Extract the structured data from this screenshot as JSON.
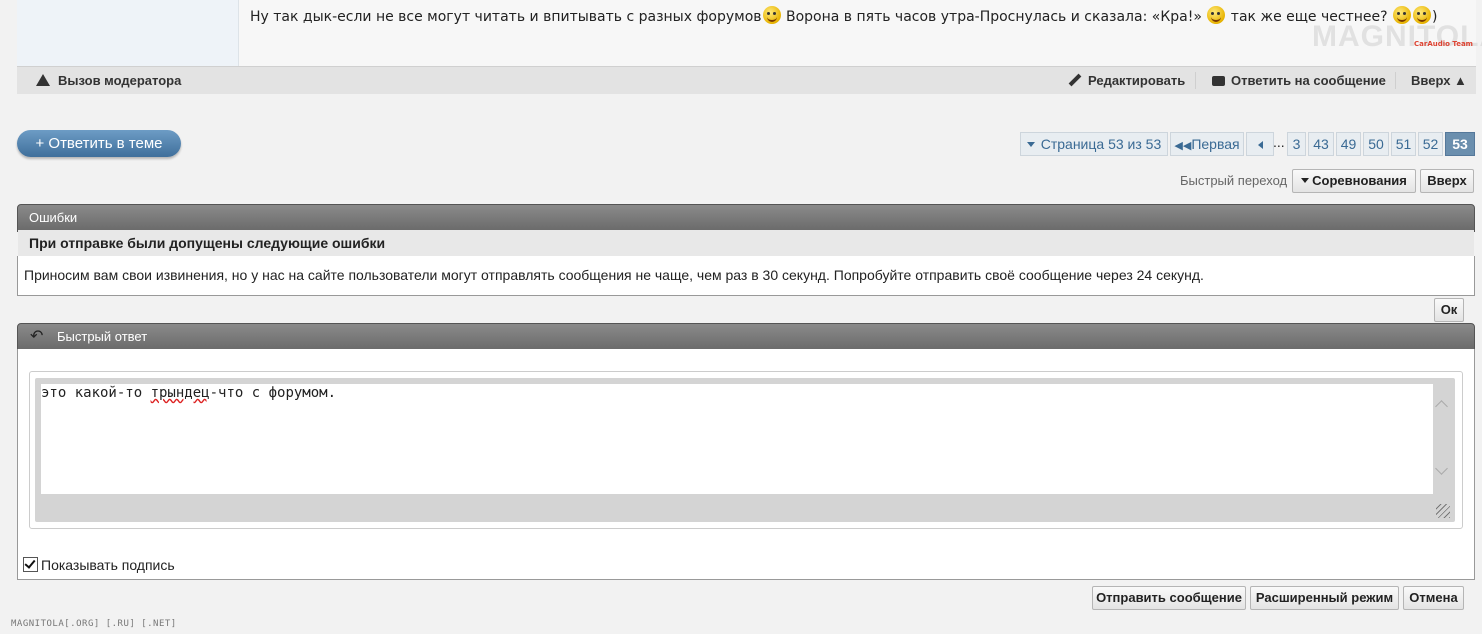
{
  "post": {
    "text_1": "Ну так дык-если не все могут читать и впитывать с разных форумов",
    "text_2": " Ворона в пять часов утра-Проснулась и сказала: «Кра!» ",
    "text_3": " так же еще честнее? ",
    "text_4": ")",
    "logo": "MAGNITOLA",
    "logo_sub": "CarAudio Team"
  },
  "post_bar": {
    "report": "Вызов модератора",
    "edit": "Редактировать",
    "reply_to": "Ответить на сообщение",
    "top": "Вверх ▲"
  },
  "reply_button": "+ Ответить в теме",
  "pagination": {
    "status": "Страница 53 из 53",
    "first": "Первая",
    "dots": "...",
    "pages": [
      "3",
      "43",
      "49",
      "50",
      "51",
      "52",
      "53"
    ],
    "current": "53"
  },
  "quick_nav": {
    "label": "Быстрый переход",
    "forum": "Соревнования",
    "top": "Вверх"
  },
  "errors": {
    "header": "Ошибки",
    "title": "При отправке были допущены следующие ошибки",
    "message": "Приносим вам свои извинения, но у нас на сайте пользователи могут отправлять сообщения не чаще, чем раз в 30 секунд. Попробуйте отправить своё сообщение через 24 секунд.",
    "ok": "Ок"
  },
  "quick_reply": {
    "header": "Быстрый ответ",
    "text_before": "это какой-то ",
    "text_misspelled": "трындец",
    "text_after": "-что с форумом.",
    "show_signature": "Показывать подпись",
    "show_signature_checked": true,
    "submit": "Отправить сообщение",
    "advanced": "Расширенный режим",
    "cancel": "Отмена"
  },
  "footer": "MAGNITOLA[.ORG] [.RU] [.NET]"
}
